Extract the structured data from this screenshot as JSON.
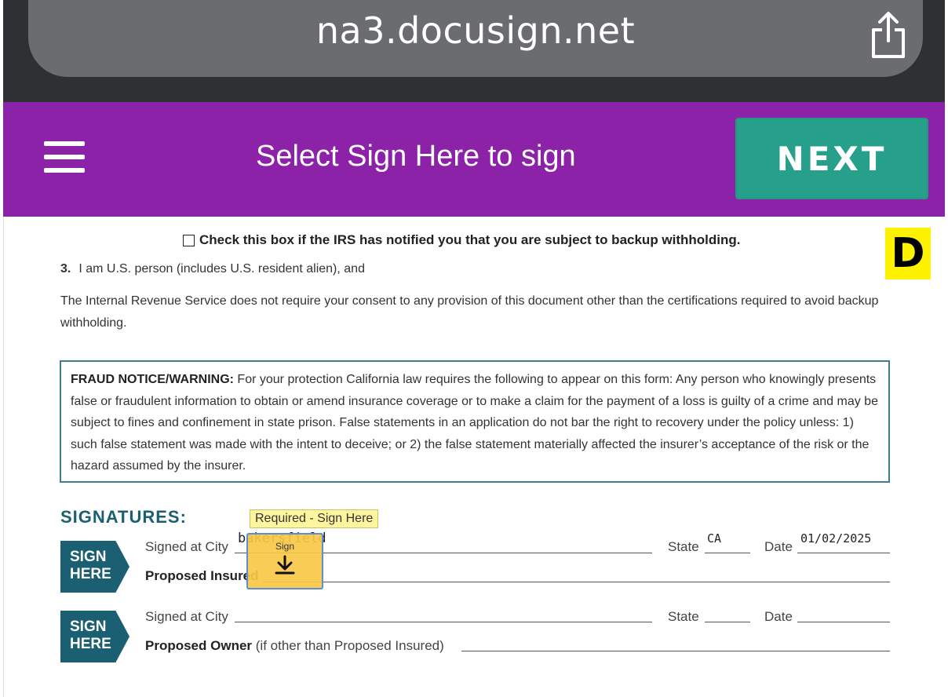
{
  "browser": {
    "url": "na3.docusign.net"
  },
  "banner": {
    "title": "Select Sign Here to sign",
    "next_label": "NEXT"
  },
  "document": {
    "checkbox_label": "Check this box if the IRS has notified you that you are subject to backup withholding.",
    "item3_number": "3.",
    "item3_text": "I am U.S. person (includes U.S. resident alien), and",
    "irs_paragraph": "The Internal Revenue Service does not require your consent to any provision of this document other than the certifications required to avoid backup withholding.",
    "fraud_heading": "FRAUD NOTICE/WARNING:",
    "fraud_text": " For your protection California law requires the following to appear on this form:  Any person who knowingly presents false or fraudulent information to obtain or amend insurance coverage or to make a claim for the payment of a loss is guilty of a crime and may be subject to fines and confinement in state prison. False statements in an application do not bar the right to recovery under the policy unless: 1) such false statement was made with the intent to deceive; or 2) the false statement materially affected the insurer’s acceptance of the risk or the hazard assumed by the insurer.",
    "signatures_heading": "SIGNATURES:"
  },
  "signature_rows": [
    {
      "badge_line1": "SIGN",
      "badge_line2": "HERE",
      "city_label": "Signed at City",
      "city_value": "bakersfield",
      "state_label": "State",
      "state_value": "CA",
      "date_label": "Date",
      "date_value": "01/02/2025",
      "signer_label": "Proposed Insured",
      "signer_note": ""
    },
    {
      "badge_line1": "SIGN",
      "badge_line2": "HERE",
      "city_label": "Signed at City",
      "city_value": "",
      "state_label": "State",
      "state_value": "",
      "date_label": "Date",
      "date_value": "",
      "signer_label": "Proposed Owner",
      "signer_note": "(if other than Proposed Insured)"
    }
  ],
  "sign_tab": {
    "tooltip": "Required - Sign Here",
    "label": "Sign",
    "icon": "download-arrow-icon"
  },
  "overlay_badge": "D",
  "colors": {
    "banner": "#8c22a8",
    "next_button": "#26a08a",
    "accent_teal": "#1a5f72",
    "sign_tab": "#f8c846",
    "badge": "#fff200"
  }
}
